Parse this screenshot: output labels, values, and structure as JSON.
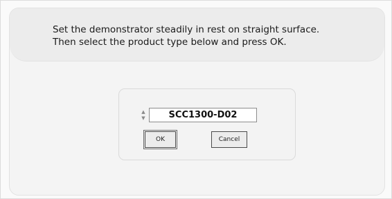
{
  "instructions": {
    "line1": "Set the demonstrator steadily in rest on straight surface.",
    "line2": "Then select the product type below and press OK."
  },
  "product_selector": {
    "value": "SCC1300-D02",
    "up_arrow": "▲",
    "down_arrow": "▼"
  },
  "buttons": {
    "ok_label": "OK",
    "cancel_label": "Cancel"
  },
  "icons": {
    "spinner": "spin-up-down-icon"
  },
  "colors": {
    "background": "#f5f5f3",
    "banner": "#ececec",
    "panel": "#f3f3f3",
    "field_border": "#8c8c8c"
  }
}
